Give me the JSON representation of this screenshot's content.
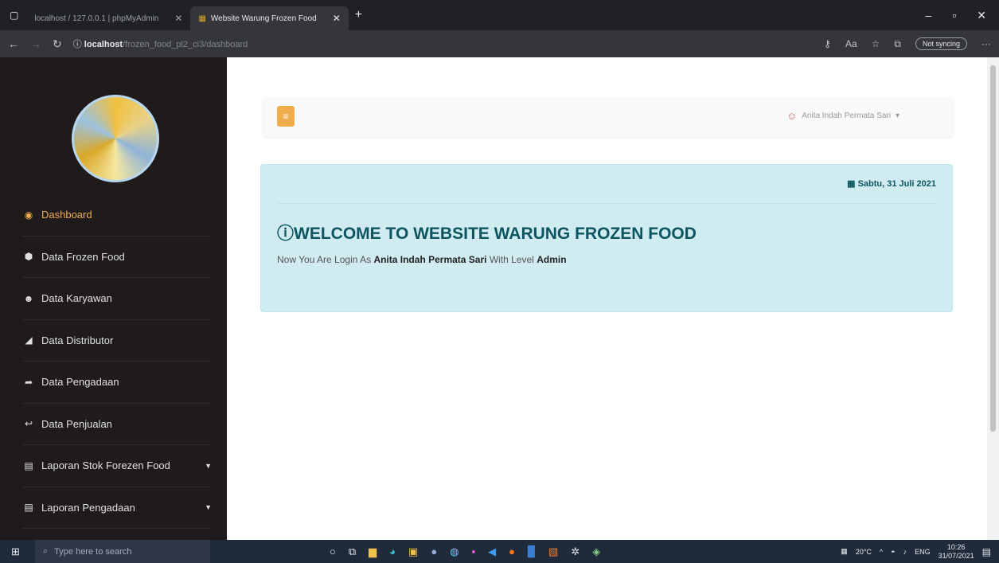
{
  "browser": {
    "tabs": [
      {
        "label": "localhost / 127.0.0.1 | phpMyAdmin"
      },
      {
        "label": "Website Warung Frozen Food"
      }
    ],
    "url_host": "localhost",
    "url_path": "/frozen_food_pl2_ci3/dashboard",
    "sync_label": "Not syncing"
  },
  "sidebar": {
    "items": [
      {
        "label": "Dashboard",
        "icon": "dashboard-icon"
      },
      {
        "label": "Data Frozen Food",
        "icon": "cubes-icon"
      },
      {
        "label": "Data Karyawan",
        "icon": "users-icon"
      },
      {
        "label": "Data Distributor",
        "icon": "car-icon"
      },
      {
        "label": "Data Pengadaan",
        "icon": "share-icon"
      },
      {
        "label": "Data Penjualan",
        "icon": "reply-icon"
      },
      {
        "label": "Laporan Stok Forezen Food",
        "icon": "file-icon"
      },
      {
        "label": "Laporan Pengadaan",
        "icon": "file-icon"
      }
    ]
  },
  "header": {
    "user_name": "Anita Indah Permata Sari"
  },
  "welcome": {
    "date": "Sabtu, 31 Juli 2021",
    "title": "WELCOME TO WEBSITE WARUNG FROZEN FOOD",
    "text_prefix": "Now You Are Login As",
    "name": "Anita Indah Permata Sari",
    "text_mid": "With Level",
    "level": "Admin"
  },
  "taskbar": {
    "search_placeholder": "Type here to search",
    "weather": "20°C",
    "lang": "ENG",
    "time": "10:26",
    "date": "31/07/2021"
  },
  "colors": {
    "accent": "#f0ad4e",
    "sidebar_bg": "#1e1b1a",
    "alert_bg": "#d1ecf1"
  }
}
